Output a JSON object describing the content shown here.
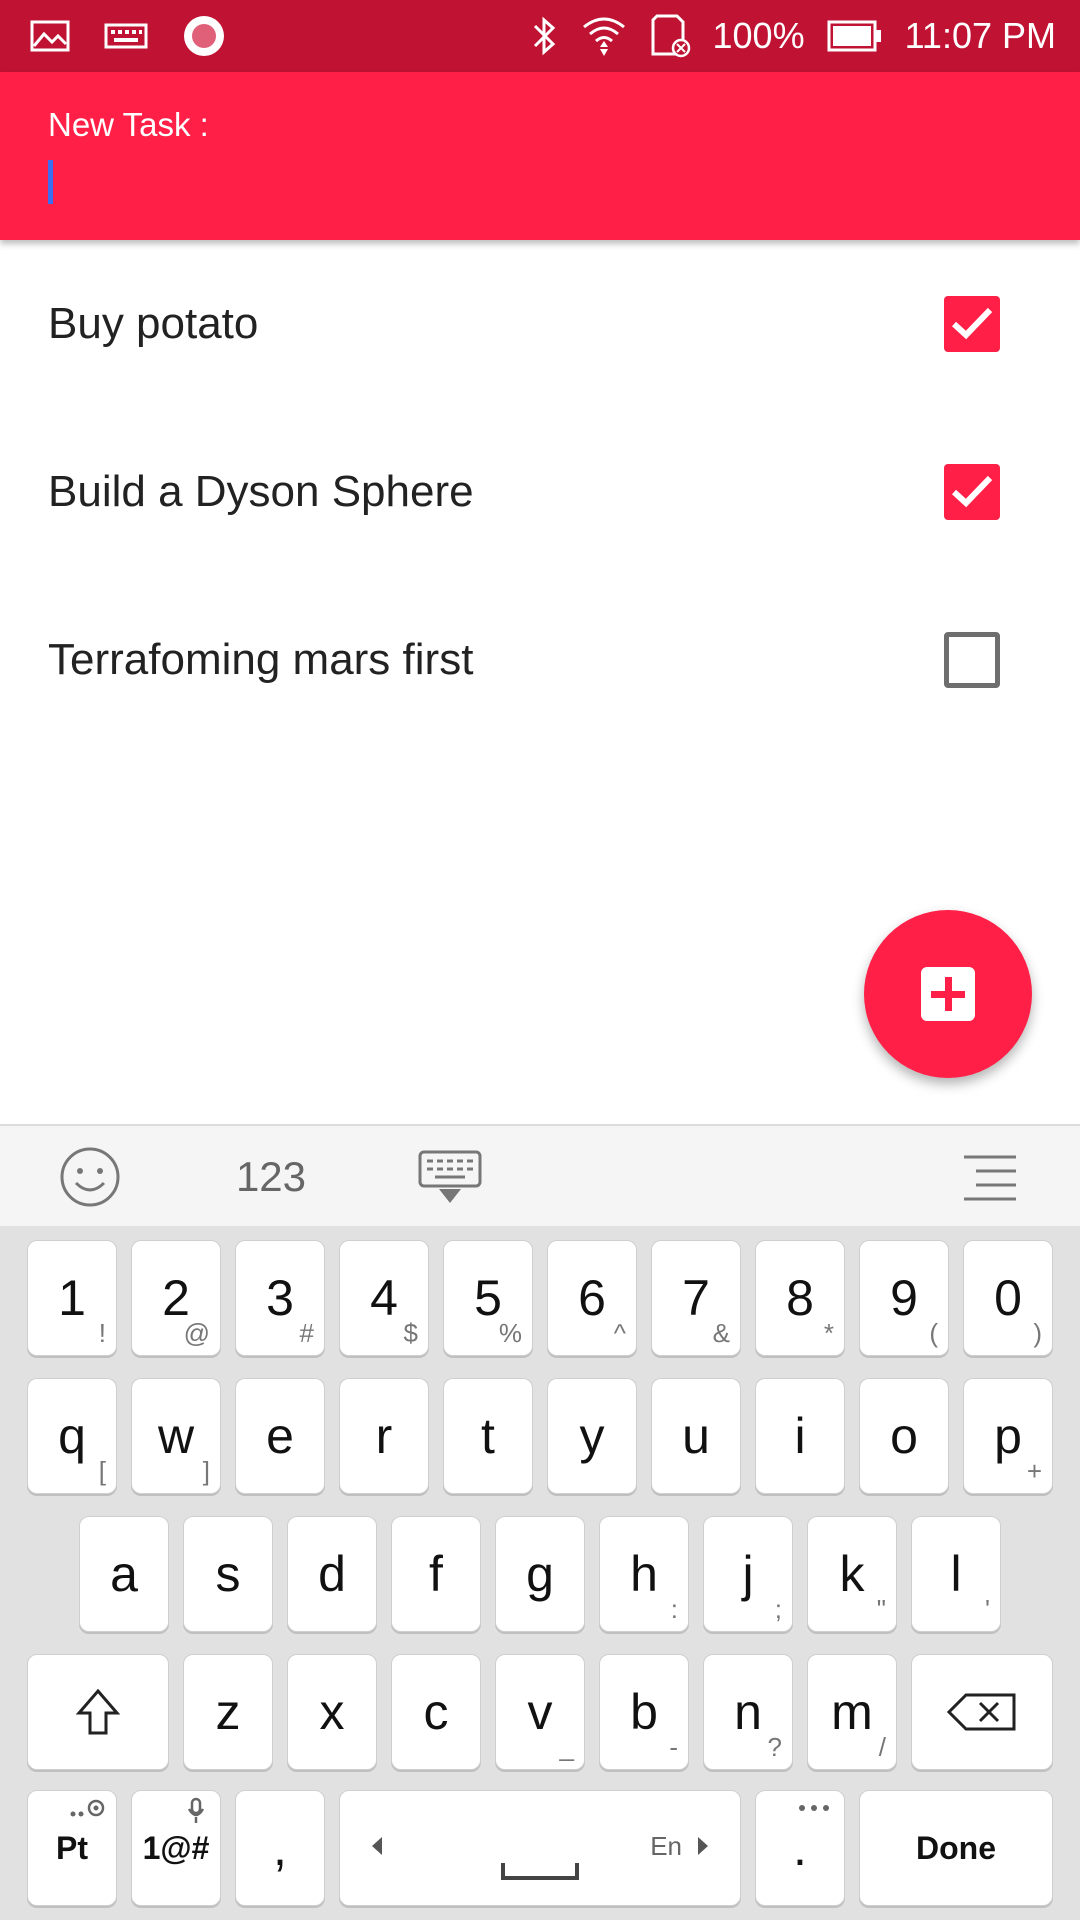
{
  "status_bar": {
    "battery_percent": "100%",
    "time": "11:07 PM",
    "icons_left": [
      "gallery-icon",
      "keyboard-icon",
      "record-icon"
    ],
    "icons_right": [
      "bluetooth-icon",
      "wifi-icon",
      "sd-card-icon",
      "battery-icon"
    ]
  },
  "header": {
    "label": "New Task :",
    "input_value": ""
  },
  "tasks": [
    {
      "label": "Buy potato",
      "checked": true
    },
    {
      "label": "Build a Dyson Sphere",
      "checked": true
    },
    {
      "label": "Terrafoming mars first",
      "checked": false
    }
  ],
  "fab": {
    "icon": "add-icon"
  },
  "keyboard": {
    "toolbar": {
      "emoji_icon": "emoji-icon",
      "numbers_label": "123",
      "hide_icon": "keyboard-hide-icon",
      "menu_icon": "menu-icon"
    },
    "row1": [
      {
        "main": "1",
        "sub": "!"
      },
      {
        "main": "2",
        "sub": "@"
      },
      {
        "main": "3",
        "sub": "#"
      },
      {
        "main": "4",
        "sub": "$"
      },
      {
        "main": "5",
        "sub": "%"
      },
      {
        "main": "6",
        "sub": "^"
      },
      {
        "main": "7",
        "sub": "&"
      },
      {
        "main": "8",
        "sub": "*"
      },
      {
        "main": "9",
        "sub": "("
      },
      {
        "main": "0",
        "sub": ")"
      }
    ],
    "row2": [
      {
        "main": "q",
        "sub": "["
      },
      {
        "main": "w",
        "sub": "]"
      },
      {
        "main": "e",
        "sub": ""
      },
      {
        "main": "r",
        "sub": ""
      },
      {
        "main": "t",
        "sub": ""
      },
      {
        "main": "y",
        "sub": ""
      },
      {
        "main": "u",
        "sub": ""
      },
      {
        "main": "i",
        "sub": ""
      },
      {
        "main": "o",
        "sub": ""
      },
      {
        "main": "p",
        "sub": "+"
      }
    ],
    "row3": [
      {
        "main": "a",
        "sub": ""
      },
      {
        "main": "s",
        "sub": ""
      },
      {
        "main": "d",
        "sub": ""
      },
      {
        "main": "f",
        "sub": ""
      },
      {
        "main": "g",
        "sub": ""
      },
      {
        "main": "h",
        "sub": ":"
      },
      {
        "main": "j",
        "sub": ";"
      },
      {
        "main": "k",
        "sub": "\""
      },
      {
        "main": "l",
        "sub": "'"
      }
    ],
    "row4": [
      {
        "main": "z",
        "sub": ""
      },
      {
        "main": "x",
        "sub": ""
      },
      {
        "main": "c",
        "sub": ""
      },
      {
        "main": "v",
        "sub": "_"
      },
      {
        "main": "b",
        "sub": "-"
      },
      {
        "main": "n",
        "sub": "?"
      },
      {
        "main": "m",
        "sub": "/"
      }
    ],
    "row5": {
      "lang_key": "Pt",
      "symbols_key": "1@#",
      "comma_key": ",",
      "space_lang": "En",
      "period_key": ".",
      "done_key": "Done"
    }
  }
}
